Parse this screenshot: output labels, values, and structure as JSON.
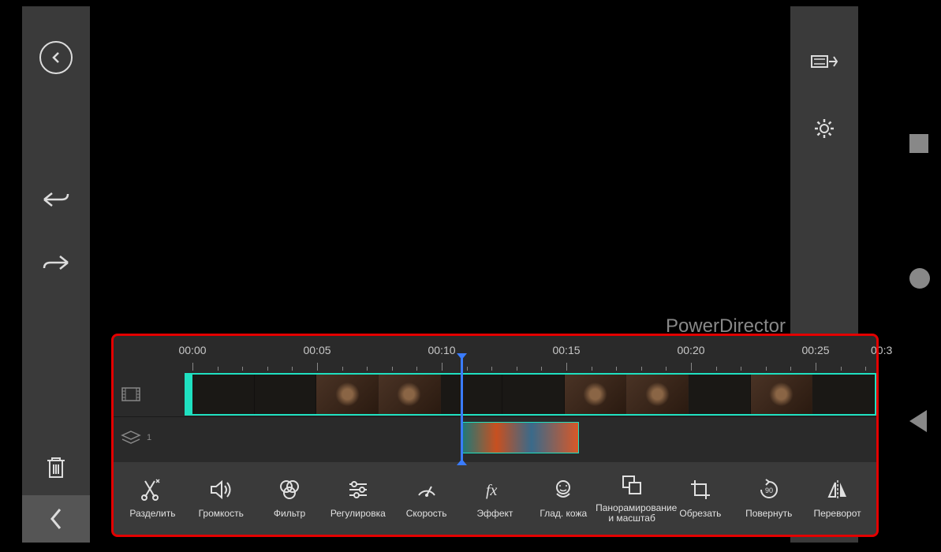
{
  "app": {
    "watermark": "PowerDirector"
  },
  "timeline": {
    "labels": [
      "00:00",
      "00:05",
      "00:10",
      "00:15",
      "00:20",
      "00:25",
      "00:3"
    ],
    "playhead_position": "00:10",
    "overlay_track_count": "1"
  },
  "tools": [
    {
      "id": "split",
      "label": "Разделить",
      "icon": "split-icon"
    },
    {
      "id": "volume",
      "label": "Громкость",
      "icon": "volume-icon"
    },
    {
      "id": "filter",
      "label": "Фильтр",
      "icon": "filter-icon"
    },
    {
      "id": "adjust",
      "label": "Регулировка",
      "icon": "adjust-icon"
    },
    {
      "id": "speed",
      "label": "Скорость",
      "icon": "speed-icon"
    },
    {
      "id": "effect",
      "label": "Эффект",
      "icon": "effect-icon"
    },
    {
      "id": "skin",
      "label": "Глад. кожа",
      "icon": "skin-icon"
    },
    {
      "id": "panzoom",
      "label": "Панорамирование и масштаб",
      "icon": "panzoom-icon",
      "wide": true
    },
    {
      "id": "crop",
      "label": "Обрезать",
      "icon": "crop-icon"
    },
    {
      "id": "rotate",
      "label": "Повернуть",
      "icon": "rotate-icon"
    },
    {
      "id": "flip",
      "label": "Переворот",
      "icon": "flip-icon"
    }
  ],
  "colors": {
    "accent": "#1fe0c0",
    "playhead": "#3a7cff",
    "highlight_border": "#e30000",
    "sidebar_bg": "#3a3a3a"
  }
}
